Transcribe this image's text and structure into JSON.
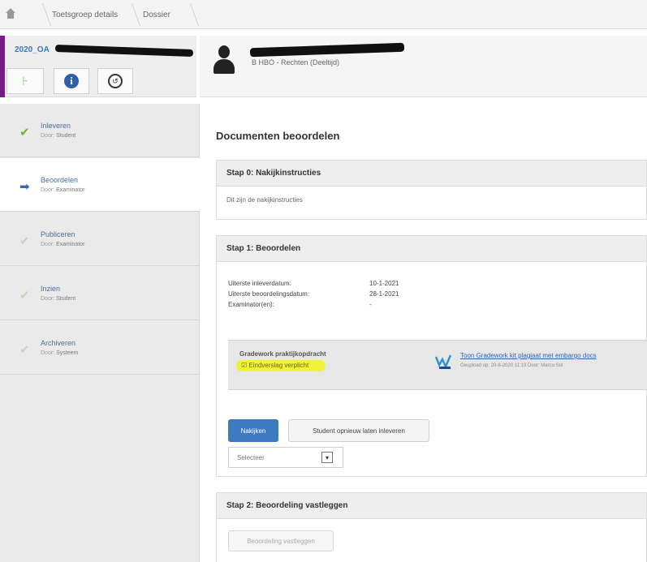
{
  "breadcrumb": {
    "home_icon": "home-icon",
    "items": [
      "Toetsgroep details",
      "Dossier"
    ]
  },
  "group": {
    "code": "2020_OA",
    "accent_color": "#7a1a8a",
    "tools": [
      "tree-icon",
      "info-icon",
      "history-icon"
    ]
  },
  "student": {
    "program": "B HBO - Rechten (Deeltijd)"
  },
  "steps": [
    {
      "title": "Inleveren",
      "by_prefix": "Door:",
      "by": "Student",
      "icon": "check-icon",
      "state": "done"
    },
    {
      "title": "Beoordelen",
      "by_prefix": "Door:",
      "by": "Examinator",
      "icon": "arrow-right-icon",
      "state": "active"
    },
    {
      "title": "Publiceren",
      "by_prefix": "Door:",
      "by": "Examinator",
      "icon": "check-icon",
      "state": "pending"
    },
    {
      "title": "Inzien",
      "by_prefix": "Door:",
      "by": "Student",
      "icon": "check-icon",
      "state": "pending"
    },
    {
      "title": "Archiveren",
      "by_prefix": "Door:",
      "by": "Systeem",
      "icon": "check-icon",
      "state": "pending"
    }
  ],
  "main": {
    "title": "Documenten beoordelen",
    "step0": {
      "heading": "Stap 0: Nakijkinstructies",
      "text": "Dit zijn de nakijkinstructies"
    },
    "step1": {
      "heading": "Stap 1: Beoordelen",
      "rows": [
        {
          "label": "Uiterste inleverdatum:",
          "value": "10-1-2021"
        },
        {
          "label": "Uiterste beoordelingsdatum:",
          "value": "28-1-2021"
        },
        {
          "label": "Examinator(en):",
          "value": "-"
        }
      ],
      "file_label": "Gradework praktijkopdracht",
      "file_note": "Eindverslag verplicht",
      "file_link": "Toon Gradework kit plagiaat met embargo docs",
      "file_meta": "Geupload op: 20-8-2020 11:19 Door: Marco Sol",
      "btn_primary": "Nakijken",
      "btn_secondary": "Student opnieuw laten inleveren",
      "select_value": "Selecteer"
    },
    "step2": {
      "heading": "Stap 2: Beoordeling vastleggen",
      "btn": "Beoordeling vastleggen"
    }
  }
}
